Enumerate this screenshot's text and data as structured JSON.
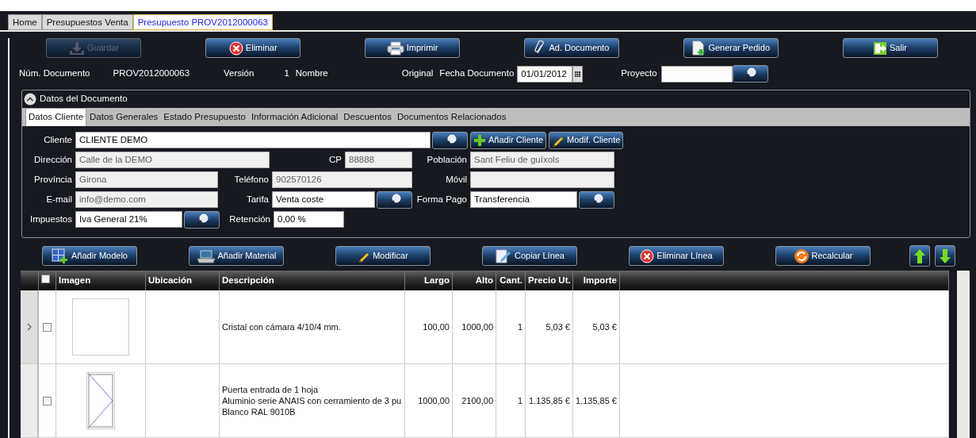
{
  "tabs": [
    {
      "label": "Home",
      "selected": false
    },
    {
      "label": "Presupuestos Venta",
      "selected": false
    },
    {
      "label": "Presupuesto PROV2012000063",
      "selected": true
    }
  ],
  "toolbar": [
    {
      "label": "Guardar",
      "kind": "save",
      "disabled": true
    },
    {
      "label": "Eliminar",
      "kind": "delete",
      "disabled": false
    },
    {
      "label": "Imprimir",
      "kind": "print",
      "disabled": false
    },
    {
      "label": "Ad. Documento",
      "kind": "attach",
      "disabled": false
    },
    {
      "label": "Generar Pedido",
      "kind": "order",
      "disabled": false
    },
    {
      "label": "Salir",
      "kind": "exit",
      "disabled": false
    }
  ],
  "document_info": {
    "number_label": "Núm. Documento",
    "number": "PROV2012000063",
    "version_label": "Versión",
    "version": "1",
    "name_label": "Nombre",
    "name": "Original",
    "date_label": "Fecha Documento",
    "date": "01/01/2012",
    "project_label": "Proyecto"
  },
  "group": {
    "title": "Datos del Documento",
    "expanded": true,
    "tabs": [
      {
        "label": "Datos Cliente",
        "selected": true
      },
      {
        "label": "Datos Generales",
        "selected": false
      },
      {
        "label": "Estado Presupuesto",
        "selected": false
      },
      {
        "label": "Información Adicional",
        "selected": false
      },
      {
        "label": "Descuentos",
        "selected": false
      },
      {
        "label": "Documentos Relacionados",
        "selected": false
      }
    ]
  },
  "client_form": [
    [
      {
        "label": "Cliente",
        "value": "CLIENTE DEMO",
        "kind": "lookup"
      }
    ],
    [
      {
        "label": "Dirección",
        "value": "Calle de la DEMO",
        "kind": "readonly"
      },
      {
        "label": "CP",
        "value": "88888",
        "kind": "readonly"
      },
      {
        "label": "Población",
        "value": "Sant Feliu de guíxols",
        "kind": "readonly"
      }
    ],
    [
      {
        "label": "Província",
        "value": "Girona",
        "kind": "readonly"
      },
      {
        "label": "Teléfono",
        "value": "902570126",
        "kind": "readonly"
      },
      {
        "label": "Móvil",
        "kind": "readonly"
      }
    ],
    [
      {
        "label": "E-mail",
        "value": "info@demo.com",
        "kind": "readonly"
      },
      {
        "label": "Tarifa",
        "value": "Venta coste",
        "kind": "lookup"
      },
      {
        "label": "Forma Pago",
        "value": "Transferencia",
        "kind": "lookup"
      }
    ],
    [
      {
        "label": "Impuestos",
        "value": "Iva General 21%",
        "kind": "lookup"
      },
      {
        "label": "Retención",
        "value": "0,00 %",
        "kind": "text"
      }
    ]
  ],
  "client_buttons": [
    {
      "label": "Añadir Cliente",
      "kind": "add"
    },
    {
      "label": "Modif. Cliente",
      "kind": "edit"
    }
  ],
  "line_buttons": [
    {
      "label": "Añadir Modelo",
      "kind": "model"
    },
    {
      "label": "Añadir Material",
      "kind": "material"
    },
    {
      "label": "Modificar",
      "kind": "edit"
    },
    {
      "label": "Copiar Línea",
      "kind": "copy"
    },
    {
      "label": "Eliminar Línea",
      "kind": "delete"
    },
    {
      "label": "Recalcular",
      "kind": "recalc"
    }
  ],
  "table": {
    "all_checked": false,
    "columns": [
      "Imagen",
      "Ubicación",
      "Descripción",
      "Largo",
      "Alto",
      "Cant.",
      "Precio Ut.",
      "Importe"
    ],
    "rows": [
      {
        "current": true,
        "checked": false,
        "kind": "glass",
        "description": "Cristal con cámara 4/10/4 mm.",
        "largo": "100,00",
        "alto": "1000,00",
        "cant": "1",
        "precio": "5,03 €",
        "importe": "5,03 €"
      },
      {
        "current": false,
        "checked": false,
        "kind": "door",
        "description": "Puerta entrada de 1 hoja\nAluminio serie ANAIS con cerramiento de 3 pu\nBlanco RAL 9010B",
        "largo": "1000,00",
        "alto": "2100,00",
        "cant": "1",
        "precio": "1.135,85 €",
        "importe": "1.135,85 €"
      }
    ]
  }
}
